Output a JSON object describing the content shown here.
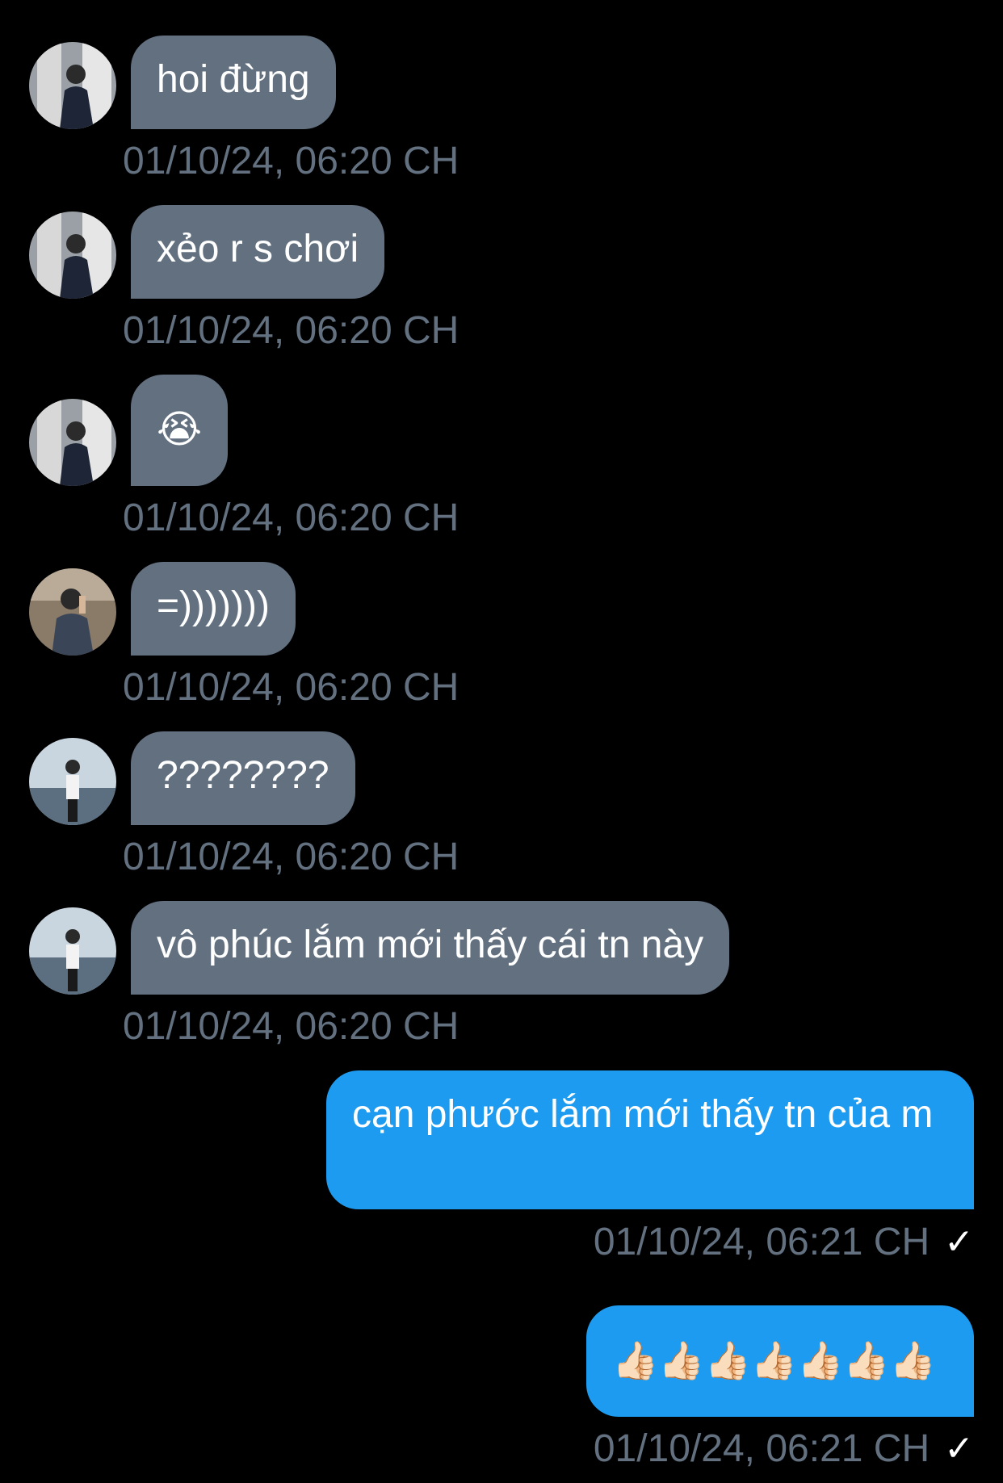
{
  "colors": {
    "background": "#000000",
    "incoming_bubble": "#627080",
    "outgoing_bubble": "#1d9bf0",
    "timestamp": "#627080",
    "text": "#ffffff"
  },
  "messages": [
    {
      "direction": "in",
      "avatar": "avatar-icon",
      "text": "hoi đừng",
      "time": "01/10/24, 06:20 CH"
    },
    {
      "direction": "in",
      "avatar": "avatar-icon",
      "text": "xẻo r s chơi",
      "time": "01/10/24, 06:20 CH"
    },
    {
      "direction": "in",
      "avatar": "avatar-icon",
      "text": "😭",
      "time": "01/10/24, 06:20 CH"
    },
    {
      "direction": "in",
      "avatar": "avatar-icon",
      "text": "=)))))))",
      "time": "01/10/24, 06:20 CH"
    },
    {
      "direction": "in",
      "avatar": "avatar-icon",
      "text": "????????",
      "time": "01/10/24, 06:20 CH"
    },
    {
      "direction": "in",
      "avatar": "avatar-icon",
      "text": "vô phúc lắm mới thấy cái tn này",
      "time": "01/10/24, 06:20 CH"
    },
    {
      "direction": "out",
      "text": "cạn phước lắm mới thấy tn của m",
      "time": "01/10/24, 06:21 CH",
      "status": "✓"
    },
    {
      "direction": "out",
      "text": "👍🏻👍🏻👍🏻👍🏻👍🏻👍🏻👍🏻",
      "time": "01/10/24, 06:21 CH",
      "status": "✓"
    }
  ]
}
